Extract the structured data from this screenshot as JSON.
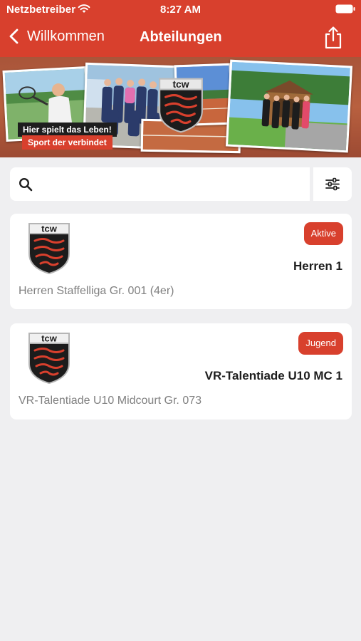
{
  "status_bar": {
    "carrier": "Netzbetreiber",
    "time": "8:27 AM"
  },
  "nav": {
    "back_label": "Willkommen",
    "title": "Abteilungen",
    "back_icon": "chevron-left-icon",
    "share_icon": "share-icon"
  },
  "banner": {
    "slogan_line1": "Hier spielt das Leben!",
    "slogan_line2": "Sport der verbindet",
    "logo_text": "tcw"
  },
  "search": {
    "placeholder": "",
    "value": "",
    "icon": "search-icon",
    "filter_icon": "sliders-icon"
  },
  "teams": [
    {
      "logo_text": "tcw",
      "badge": "Aktive",
      "name": "Herren 1",
      "league": "Herren Staffelliga Gr. 001 (4er)"
    },
    {
      "logo_text": "tcw",
      "badge": "Jugend",
      "name": "VR-Talentiade U10 MC 1",
      "league": "VR-Talentiade U10 Midcourt Gr. 073"
    }
  ],
  "colors": {
    "brand_red": "#d8402d",
    "background": "#efeff1",
    "card": "#ffffff",
    "secondary_text": "#808080"
  }
}
